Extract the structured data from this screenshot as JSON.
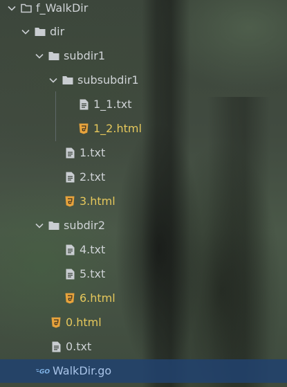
{
  "colors": {
    "folder_text": "#cfd3d6",
    "txt_text": "#cfd3d6",
    "html_text": "#e6c85c",
    "go_text": "#a9c4e8",
    "selection": "#21426e",
    "html_icon": "#e8a33c"
  },
  "tree": {
    "root": {
      "label": "f_WalkDir",
      "icon": "folder-outline-icon",
      "expanded": true
    },
    "dir": {
      "label": "dir",
      "icon": "folder-icon",
      "expanded": true
    },
    "subdir1": {
      "label": "subdir1",
      "icon": "folder-icon",
      "expanded": true
    },
    "subsubdir1": {
      "label": "subsubdir1",
      "icon": "folder-icon",
      "expanded": true
    },
    "file_1_1_txt": {
      "label": "1_1.txt",
      "icon": "text-file-icon"
    },
    "file_1_2_html": {
      "label": "1_2.html",
      "icon": "html5-icon"
    },
    "file_1_txt": {
      "label": "1.txt",
      "icon": "text-file-icon"
    },
    "file_2_txt": {
      "label": "2.txt",
      "icon": "text-file-icon"
    },
    "file_3_html": {
      "label": "3.html",
      "icon": "html5-icon"
    },
    "subdir2": {
      "label": "subdir2",
      "icon": "folder-icon",
      "expanded": true
    },
    "file_4_txt": {
      "label": "4.txt",
      "icon": "text-file-icon"
    },
    "file_5_txt": {
      "label": "5.txt",
      "icon": "text-file-icon"
    },
    "file_6_html": {
      "label": "6.html",
      "icon": "html5-icon"
    },
    "file_0_html": {
      "label": "0.html",
      "icon": "html5-icon"
    },
    "file_0_txt": {
      "label": "0.txt",
      "icon": "text-file-icon"
    },
    "file_walkdir_go": {
      "label": "WalkDir.go",
      "icon": "go-file-icon",
      "selected": true
    }
  }
}
